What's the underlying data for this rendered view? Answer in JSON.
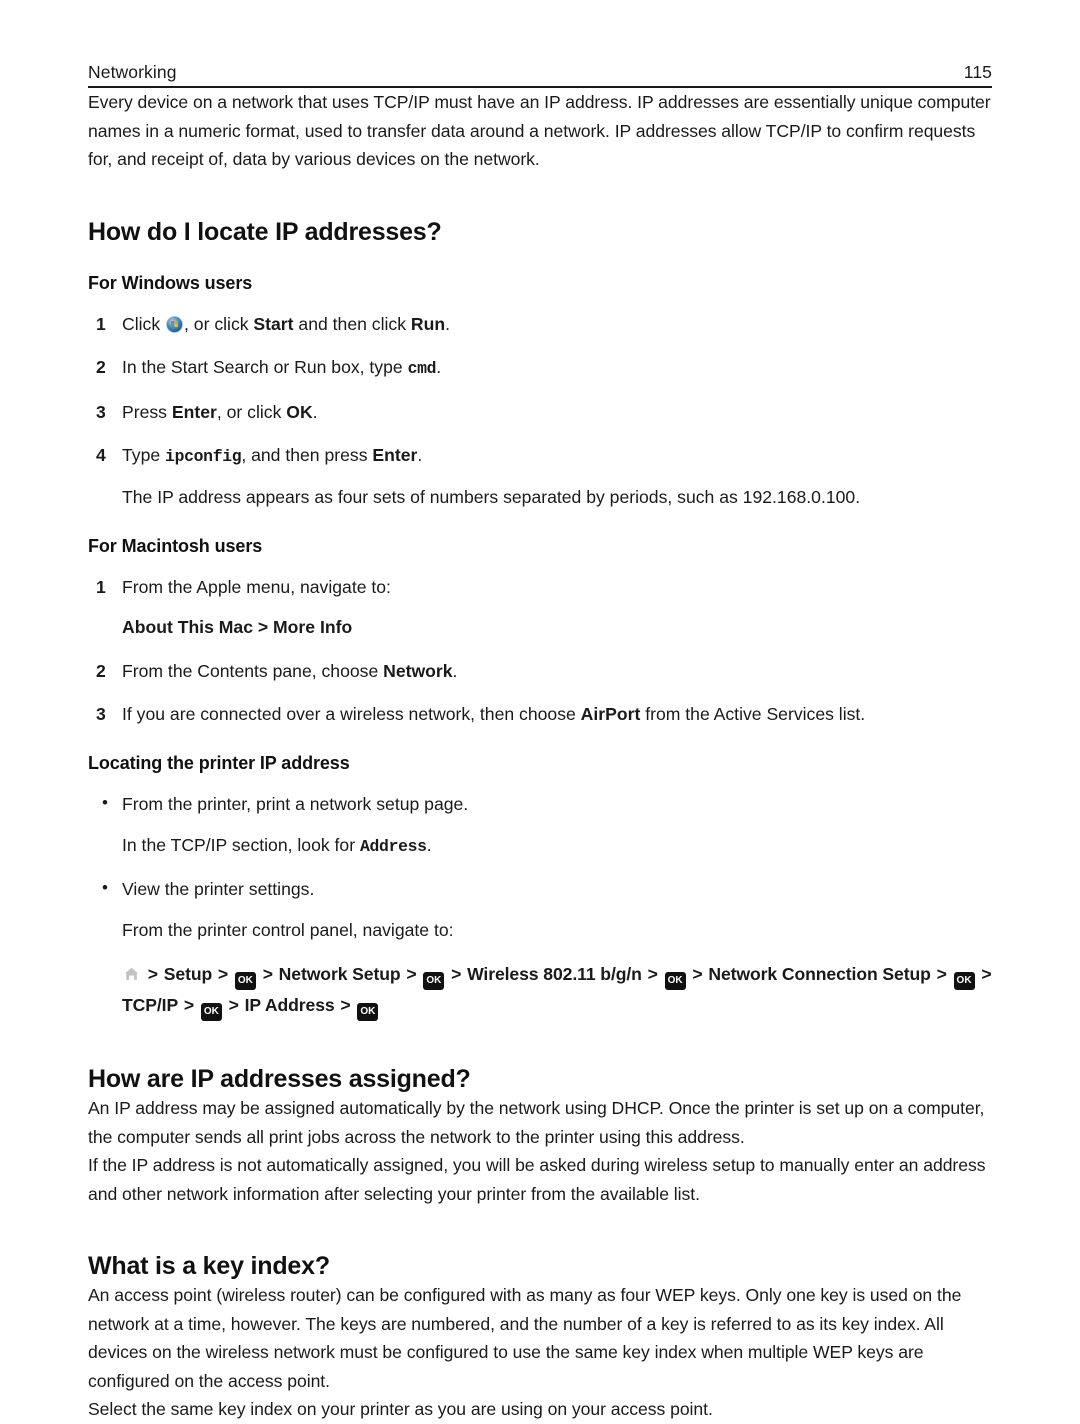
{
  "header": {
    "section": "Networking",
    "page_number": "115"
  },
  "intro": "Every device on a network that uses TCP/IP must have an IP address. IP addresses are essentially unique computer names in a numeric format, used to transfer data around a network. IP addresses allow TCP/IP to confirm requests for, and receipt of, data by various devices on the network.",
  "sections": [
    {
      "heading": "How do I locate IP addresses?",
      "windows": {
        "subheading": "For Windows users",
        "steps": [
          {
            "num": "1",
            "pre": "Click ",
            "icon": "windows-start-orb-icon",
            "post_a": ", or click ",
            "bold_a": "Start",
            "post_b": " and then click ",
            "bold_b": "Run",
            "post_c": "."
          },
          {
            "num": "2",
            "pre": "In the Start Search or Run box, type ",
            "mono": "cmd",
            "post": "."
          },
          {
            "num": "3",
            "pre": "Press ",
            "bold_a": "Enter",
            "mid": ", or click ",
            "bold_b": "OK",
            "post": "."
          },
          {
            "num": "4",
            "pre": "Type ",
            "mono": "ipconfig",
            "mid": ", and then press ",
            "bold_a": "Enter",
            "post": ".",
            "continuation": "The IP address appears as four sets of numbers separated by periods, such as 192.168.0.100."
          }
        ]
      },
      "macintosh": {
        "subheading": "For Macintosh users",
        "steps": [
          {
            "num": "1",
            "text": "From the Apple menu, navigate to:",
            "continuation_bold": "About This Mac > More Info"
          },
          {
            "num": "2",
            "pre": "From the Contents pane, choose ",
            "bold_a": "Network",
            "post": "."
          },
          {
            "num": "3",
            "pre": "If you are connected over a wireless network, then choose ",
            "bold_a": "AirPort",
            "post": " from the Active Services list."
          }
        ]
      },
      "printer": {
        "subheading": "Locating the printer IP address",
        "bullets": [
          {
            "text": "From the printer, print a network setup page.",
            "cont_pre": "In the TCP/IP section, look for ",
            "cont_mono": "Address",
            "cont_post": "."
          },
          {
            "text": "View the printer settings.",
            "cont_pre": "From the printer control panel, navigate to:"
          }
        ],
        "nav_path": {
          "line1": [
            {
              "type": "home-icon",
              "value": "home-icon"
            },
            {
              "type": "sep",
              "value": ">"
            },
            {
              "type": "label",
              "value": "Setup"
            },
            {
              "type": "sep",
              "value": ">"
            },
            {
              "type": "ok-key",
              "value": "OK"
            },
            {
              "type": "sep",
              "value": ">"
            },
            {
              "type": "label",
              "value": "Network Setup"
            },
            {
              "type": "sep",
              "value": ">"
            },
            {
              "type": "ok-key",
              "value": "OK"
            },
            {
              "type": "sep",
              "value": ">"
            },
            {
              "type": "label",
              "value": "Wireless 802.11 b/g/n"
            },
            {
              "type": "sep",
              "value": ">"
            },
            {
              "type": "ok-key",
              "value": "OK"
            },
            {
              "type": "sep",
              "value": ">"
            },
            {
              "type": "label",
              "value": "Network Connection Setup"
            },
            {
              "type": "sep",
              "value": ">"
            },
            {
              "type": "ok-key",
              "value": "OK"
            },
            {
              "type": "sep",
              "value": ">"
            },
            {
              "type": "label",
              "value": "TCP/IP"
            },
            {
              "type": "sep",
              "value": ">"
            },
            {
              "type": "ok-key",
              "value": "OK"
            },
            {
              "type": "sep",
              "value": ">"
            },
            {
              "type": "label",
              "value": "IP Address"
            },
            {
              "type": "sep",
              "value": ">"
            },
            {
              "type": "ok-key",
              "value": "OK"
            }
          ]
        }
      }
    },
    {
      "heading": "How are IP addresses assigned?",
      "paragraphs": [
        "An IP address may be assigned automatically by the network using DHCP. Once the printer is set up on a computer, the computer sends all print jobs across the network to the printer using this address.",
        "If the IP address is not automatically assigned, you will be asked during wireless setup to manually enter an address and other network information after selecting your printer from the available list."
      ]
    },
    {
      "heading": "What is a key index?",
      "paragraphs": [
        "An access point (wireless router) can be configured with as many as four WEP keys. Only one key is used on the network at a time, however. The keys are numbered, and the number of a key is referred to as its key index. All devices on the wireless network must be configured to use the same key index when multiple WEP keys are configured on the access point.",
        "Select the same key index on your printer as you are using on your access point."
      ]
    }
  ],
  "colors": {
    "text": "#1a1a1a",
    "key_background": "#111111",
    "key_foreground": "#ffffff",
    "home_icon": "#bdbdbd"
  }
}
